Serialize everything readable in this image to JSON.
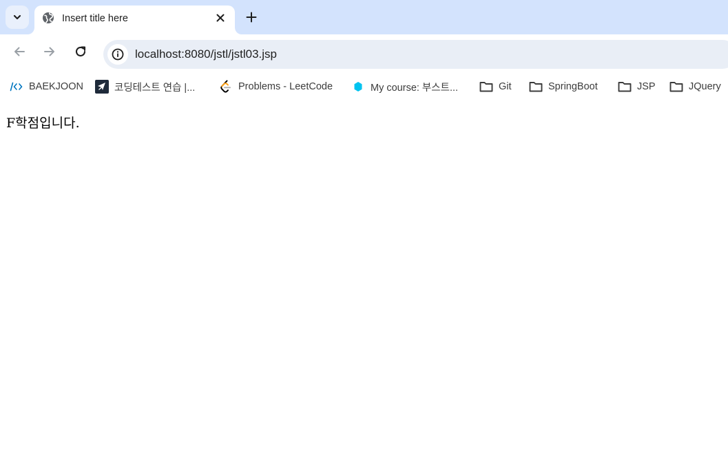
{
  "tab": {
    "title": "Insert title here",
    "favicon": "globe-icon"
  },
  "toolbar": {
    "url": "localhost:8080/jstl/jstl03.jsp"
  },
  "bookmarks": [
    {
      "label": "BAEKJOON",
      "icon": "baekjoon-icon"
    },
    {
      "label": "코딩테스트 연습 |...",
      "icon": "programmers-icon"
    },
    {
      "label": "Problems - LeetCode",
      "icon": "leetcode-icon"
    },
    {
      "label": "My course: 부스트...",
      "icon": "boostcourse-icon"
    },
    {
      "label": "Git",
      "icon": "folder-icon"
    },
    {
      "label": "SpringBoot",
      "icon": "folder-icon"
    },
    {
      "label": "JSP",
      "icon": "folder-icon"
    },
    {
      "label": "JQuery",
      "icon": "folder-icon"
    }
  ],
  "page": {
    "content": "F학점입니다."
  },
  "colors": {
    "tabstrip_bg": "#d3e3fd",
    "omnibox_bg": "#e9eef6",
    "baekjoon_blue": "#0076c0",
    "boostcourse_cyan": "#00c3f0",
    "leetcode_orange": "#ffa116"
  }
}
